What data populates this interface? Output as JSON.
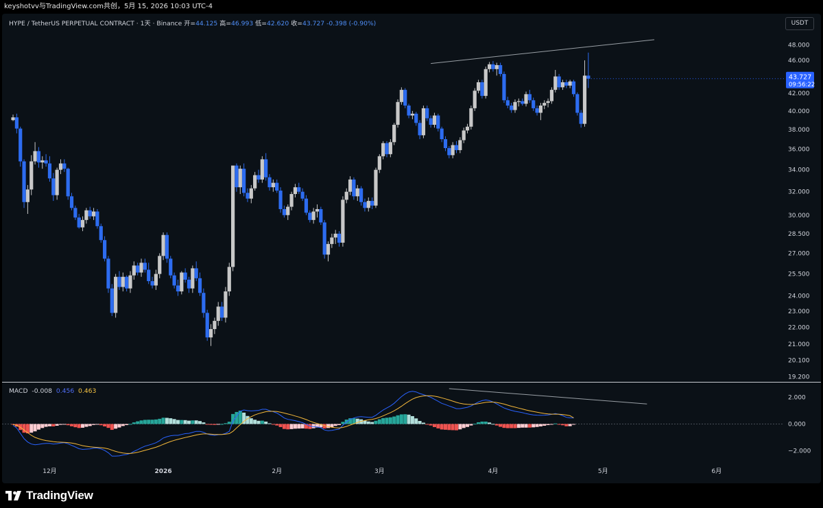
{
  "header": {
    "watermark": "keyshotvv与TradingView.com共创，5月 15, 2026 10:03 UTC-4"
  },
  "symbol": {
    "name": "HYPE / TetherUS PERPETUAL CONTRACT · 1天 · Binance",
    "open_label": "开=",
    "open": "44.125",
    "high_label": "高=",
    "high": "46.993",
    "low_label": "低=",
    "low": "42.620",
    "close_label": "收=",
    "close": "43.727",
    "change": "-0.398 (-0.90%)"
  },
  "currency": "USDT",
  "price_tag": {
    "price": "43.727",
    "countdown": "09:56:22"
  },
  "macd_legend": {
    "label": "MACD",
    "hist": "-0.008",
    "macd": "0.456",
    "signal": "0.463"
  },
  "footer": {
    "brand": "TradingView"
  },
  "colors": {
    "up": "#c8c8c8",
    "down": "#2d6cf0",
    "hist_pos": "#26a69a",
    "hist_pos_light": "#b2dfdb",
    "hist_neg": "#ef5350",
    "hist_neg_light": "#ffcdd2",
    "macd_line": "#2962ff",
    "signal_line": "#f6b93b",
    "background": "#0b1117"
  },
  "chart_data": [
    {
      "type": "candlestick",
      "yscale": "log",
      "ylim": [
        19.0,
        50.0
      ],
      "y_ticks": [
        "48.000",
        "46.000",
        "42.000",
        "40.000",
        "38.000",
        "36.000",
        "34.000",
        "32.000",
        "30.000",
        "28.500",
        "27.000",
        "25.500",
        "24.000",
        "23.000",
        "22.000",
        "21.000",
        "20.100",
        "19.200"
      ],
      "x_ticks": [
        "12月",
        "2026",
        "2月",
        "3月",
        "4月",
        "5月",
        "6月"
      ],
      "x_range": [
        "2025-11-18",
        "2026-06-16"
      ],
      "last_price": 43.727,
      "trendline": {
        "from": {
          "date": "2026-03-15",
          "price": 45.6
        },
        "to": {
          "date": "2026-05-15",
          "price": 48.7
        }
      },
      "candles": [
        [
          39.0,
          39.6,
          38.9,
          39.3
        ],
        [
          39.3,
          39.7,
          37.6,
          38.1
        ],
        [
          38.1,
          38.3,
          34.3,
          34.8
        ],
        [
          34.8,
          35.0,
          30.6,
          31.1
        ],
        [
          31.1,
          32.6,
          30.1,
          32.2
        ],
        [
          32.2,
          35.4,
          31.7,
          34.8
        ],
        [
          34.8,
          36.7,
          34.5,
          35.8
        ],
        [
          35.8,
          36.2,
          34.2,
          34.7
        ],
        [
          34.7,
          35.3,
          34.1,
          34.9
        ],
        [
          34.9,
          35.5,
          34.3,
          34.6
        ],
        [
          34.6,
          35.3,
          32.9,
          33.2
        ],
        [
          33.2,
          33.7,
          31.2,
          31.7
        ],
        [
          31.7,
          34.2,
          31.3,
          34.0
        ],
        [
          34.0,
          35.0,
          33.6,
          34.6
        ],
        [
          34.6,
          35.0,
          33.8,
          34.1
        ],
        [
          34.1,
          34.2,
          31.3,
          31.6
        ],
        [
          31.6,
          31.9,
          30.4,
          30.6
        ],
        [
          30.6,
          30.8,
          29.6,
          29.8
        ],
        [
          29.8,
          30.1,
          28.9,
          29.0
        ],
        [
          29.0,
          29.9,
          28.7,
          29.6
        ],
        [
          29.6,
          30.6,
          29.3,
          30.4
        ],
        [
          30.4,
          30.7,
          29.7,
          29.9
        ],
        [
          29.9,
          30.6,
          29.6,
          30.3
        ],
        [
          30.3,
          30.5,
          28.9,
          29.1
        ],
        [
          29.1,
          29.3,
          27.8,
          28.0
        ],
        [
          28.0,
          28.3,
          26.4,
          26.6
        ],
        [
          26.6,
          26.8,
          24.2,
          24.5
        ],
        [
          24.5,
          24.8,
          22.7,
          22.9
        ],
        [
          22.9,
          25.5,
          22.6,
          25.3
        ],
        [
          25.3,
          25.7,
          24.4,
          24.6
        ],
        [
          24.6,
          25.6,
          24.3,
          25.3
        ],
        [
          25.3,
          25.4,
          24.3,
          24.5
        ],
        [
          24.5,
          25.7,
          24.2,
          25.4
        ],
        [
          25.4,
          26.4,
          25.1,
          26.1
        ],
        [
          26.1,
          26.3,
          25.4,
          25.6
        ],
        [
          25.6,
          26.6,
          25.3,
          26.3
        ],
        [
          26.3,
          26.6,
          25.6,
          25.8
        ],
        [
          25.8,
          26.3,
          24.8,
          25.0
        ],
        [
          25.0,
          25.3,
          24.5,
          24.7
        ],
        [
          24.7,
          25.8,
          24.4,
          25.5
        ],
        [
          25.5,
          27.0,
          25.2,
          26.8
        ],
        [
          26.8,
          28.6,
          26.5,
          28.4
        ],
        [
          28.4,
          28.6,
          26.3,
          26.6
        ],
        [
          26.6,
          26.8,
          25.2,
          25.4
        ],
        [
          25.4,
          25.6,
          24.5,
          24.7
        ],
        [
          24.7,
          25.1,
          24.0,
          24.3
        ],
        [
          24.3,
          25.7,
          24.1,
          25.6
        ],
        [
          25.6,
          25.9,
          24.9,
          25.1
        ],
        [
          25.1,
          25.3,
          24.2,
          24.5
        ],
        [
          24.5,
          26.1,
          24.2,
          25.9
        ],
        [
          25.9,
          26.4,
          25.0,
          25.2
        ],
        [
          25.2,
          25.6,
          24.0,
          24.2
        ],
        [
          24.2,
          24.5,
          22.6,
          22.9
        ],
        [
          22.9,
          23.1,
          21.2,
          21.4
        ],
        [
          21.4,
          22.2,
          20.9,
          21.9
        ],
        [
          21.9,
          22.6,
          21.6,
          22.4
        ],
        [
          22.4,
          23.6,
          22.1,
          23.3
        ],
        [
          23.3,
          23.6,
          22.4,
          22.6
        ],
        [
          22.6,
          24.6,
          22.3,
          24.3
        ],
        [
          24.3,
          26.3,
          24.0,
          26.0
        ],
        [
          26.0,
          34.0,
          25.7,
          34.4
        ],
        [
          34.4,
          34.6,
          32.0,
          32.4
        ],
        [
          32.4,
          34.4,
          31.8,
          34.1
        ],
        [
          34.1,
          34.6,
          31.6,
          31.9
        ],
        [
          31.9,
          32.3,
          31.1,
          31.4
        ],
        [
          31.4,
          32.6,
          31.0,
          32.3
        ],
        [
          32.3,
          33.8,
          32.1,
          33.5
        ],
        [
          33.5,
          34.0,
          32.8,
          33.1
        ],
        [
          33.1,
          35.3,
          32.8,
          35.0
        ],
        [
          35.0,
          35.6,
          33.0,
          33.3
        ],
        [
          33.3,
          33.6,
          32.1,
          32.4
        ],
        [
          32.4,
          33.1,
          32.0,
          32.8
        ],
        [
          32.8,
          33.1,
          31.9,
          32.1
        ],
        [
          32.1,
          32.4,
          30.2,
          30.5
        ],
        [
          30.5,
          30.8,
          29.8,
          30.0
        ],
        [
          30.0,
          30.9,
          29.6,
          30.7
        ],
        [
          30.7,
          32.0,
          30.4,
          31.8
        ],
        [
          31.8,
          32.7,
          31.5,
          32.4
        ],
        [
          32.4,
          32.8,
          31.8,
          32.0
        ],
        [
          32.0,
          32.3,
          31.2,
          31.4
        ],
        [
          31.4,
          31.7,
          30.0,
          30.2
        ],
        [
          30.2,
          30.4,
          29.4,
          29.6
        ],
        [
          29.6,
          30.6,
          29.3,
          30.3
        ],
        [
          30.3,
          30.9,
          29.8,
          30.5
        ],
        [
          30.5,
          30.7,
          29.2,
          29.4
        ],
        [
          29.4,
          29.6,
          26.6,
          26.9
        ],
        [
          26.9,
          27.9,
          26.4,
          27.7
        ],
        [
          27.7,
          28.5,
          27.4,
          28.2
        ],
        [
          28.2,
          28.8,
          27.7,
          28.5
        ],
        [
          28.5,
          28.7,
          27.5,
          27.8
        ],
        [
          27.8,
          31.6,
          27.5,
          31.3
        ],
        [
          31.3,
          32.3,
          31.0,
          32.0
        ],
        [
          32.0,
          33.4,
          31.7,
          33.1
        ],
        [
          33.1,
          33.3,
          31.3,
          31.6
        ],
        [
          31.6,
          32.6,
          31.2,
          32.3
        ],
        [
          32.3,
          32.5,
          30.8,
          31.1
        ],
        [
          31.1,
          31.4,
          30.3,
          30.6
        ],
        [
          30.6,
          31.5,
          30.3,
          31.2
        ],
        [
          31.2,
          31.5,
          30.5,
          30.8
        ],
        [
          30.8,
          34.2,
          30.6,
          34.0
        ],
        [
          34.0,
          35.5,
          33.7,
          35.3
        ],
        [
          35.3,
          36.8,
          35.0,
          36.6
        ],
        [
          36.6,
          36.8,
          35.2,
          35.5
        ],
        [
          35.5,
          37.0,
          35.2,
          36.7
        ],
        [
          36.7,
          38.7,
          36.4,
          38.5
        ],
        [
          38.5,
          41.3,
          38.2,
          41.0
        ],
        [
          41.0,
          42.7,
          40.7,
          42.4
        ],
        [
          42.4,
          42.6,
          40.3,
          40.6
        ],
        [
          40.6,
          40.8,
          39.2,
          39.5
        ],
        [
          39.5,
          40.0,
          39.1,
          39.7
        ],
        [
          39.7,
          39.9,
          38.4,
          38.7
        ],
        [
          38.7,
          39.0,
          37.0,
          37.4
        ],
        [
          37.4,
          40.6,
          37.1,
          40.3
        ],
        [
          40.3,
          40.6,
          38.9,
          39.2
        ],
        [
          39.2,
          39.5,
          38.2,
          38.5
        ],
        [
          38.5,
          39.8,
          38.2,
          39.5
        ],
        [
          39.5,
          39.7,
          37.8,
          38.1
        ],
        [
          38.1,
          38.3,
          36.7,
          37.0
        ],
        [
          37.0,
          37.3,
          35.8,
          36.1
        ],
        [
          36.1,
          36.3,
          35.1,
          35.4
        ],
        [
          35.4,
          36.7,
          35.1,
          36.4
        ],
        [
          36.4,
          36.8,
          35.6,
          35.9
        ],
        [
          35.9,
          37.2,
          35.6,
          36.9
        ],
        [
          36.9,
          38.2,
          36.6,
          37.9
        ],
        [
          37.9,
          38.6,
          37.6,
          38.3
        ],
        [
          38.3,
          40.6,
          38.0,
          40.3
        ],
        [
          40.3,
          42.6,
          40.0,
          42.3
        ],
        [
          42.3,
          43.6,
          42.0,
          43.3
        ],
        [
          43.3,
          43.6,
          41.4,
          41.7
        ],
        [
          41.7,
          45.2,
          41.4,
          44.9
        ],
        [
          44.9,
          45.8,
          44.5,
          45.5
        ],
        [
          45.5,
          45.9,
          44.6,
          44.9
        ],
        [
          44.9,
          45.7,
          44.1,
          45.4
        ],
        [
          45.4,
          45.7,
          44.0,
          44.3
        ],
        [
          44.3,
          44.6,
          40.9,
          41.2
        ],
        [
          41.2,
          41.6,
          40.3,
          40.6
        ],
        [
          40.6,
          40.9,
          39.8,
          40.1
        ],
        [
          40.1,
          41.3,
          39.8,
          41.0
        ],
        [
          41.0,
          41.4,
          40.5,
          41.1
        ],
        [
          41.1,
          41.4,
          40.6,
          40.8
        ],
        [
          40.8,
          42.2,
          40.5,
          41.9
        ],
        [
          41.9,
          42.4,
          40.9,
          41.2
        ],
        [
          41.2,
          41.5,
          40.0,
          40.3
        ],
        [
          40.3,
          40.6,
          39.5,
          39.8
        ],
        [
          39.8,
          40.9,
          39.0,
          40.6
        ],
        [
          40.6,
          41.2,
          40.2,
          40.9
        ],
        [
          40.9,
          41.4,
          40.4,
          41.1
        ],
        [
          41.1,
          42.7,
          40.8,
          42.4
        ],
        [
          42.4,
          44.8,
          42.1,
          44.0
        ],
        [
          44.0,
          44.3,
          42.4,
          42.7
        ],
        [
          42.7,
          43.6,
          42.4,
          43.3
        ],
        [
          43.3,
          43.6,
          42.6,
          42.9
        ],
        [
          42.9,
          43.6,
          42.6,
          43.4
        ],
        [
          43.4,
          43.6,
          41.6,
          41.9
        ],
        [
          41.9,
          42.1,
          39.5,
          39.8
        ],
        [
          39.8,
          40.1,
          38.2,
          38.6
        ],
        [
          38.6,
          46.0,
          38.3,
          44.1
        ],
        [
          44.1,
          46.993,
          42.62,
          43.727
        ]
      ]
    },
    {
      "type": "macd",
      "ylim": [
        -2.9,
        3.0
      ],
      "y_ticks": [
        "2.000",
        "0.000",
        "−2.000"
      ],
      "annotation_line": {
        "from": {
          "date": "2026-03-20",
          "value": 2.65
        },
        "to": {
          "date": "2026-05-13",
          "value": 1.5
        }
      },
      "macd": [
        -0.1,
        -0.3,
        -0.7,
        -1.1,
        -1.35,
        -1.5,
        -1.55,
        -1.52,
        -1.48,
        -1.45,
        -1.45,
        -1.5,
        -1.48,
        -1.42,
        -1.4,
        -1.48,
        -1.6,
        -1.72,
        -1.85,
        -1.9,
        -1.88,
        -1.86,
        -1.8,
        -1.8,
        -1.86,
        -1.98,
        -2.15,
        -2.4,
        -2.4,
        -2.38,
        -2.32,
        -2.28,
        -2.2,
        -2.05,
        -1.92,
        -1.78,
        -1.66,
        -1.58,
        -1.5,
        -1.4,
        -1.25,
        -1.05,
        -0.95,
        -0.88,
        -0.85,
        -0.85,
        -0.78,
        -0.72,
        -0.7,
        -0.62,
        -0.55,
        -0.55,
        -0.62,
        -0.75,
        -0.82,
        -0.85,
        -0.8,
        -0.78,
        -0.7,
        -0.55,
        0.2,
        0.6,
        0.95,
        1.05,
        1.0,
        0.98,
        1.0,
        1.02,
        1.1,
        1.1,
        1.0,
        0.92,
        0.82,
        0.65,
        0.45,
        0.35,
        0.3,
        0.25,
        0.18,
        0.1,
        -0.02,
        -0.15,
        -0.2,
        -0.22,
        -0.28,
        -0.45,
        -0.5,
        -0.48,
        -0.42,
        -0.38,
        -0.1,
        0.15,
        0.35,
        0.45,
        0.52,
        0.55,
        0.52,
        0.5,
        0.5,
        0.65,
        0.85,
        1.05,
        1.2,
        1.35,
        1.55,
        1.8,
        2.05,
        2.25,
        2.4,
        2.45,
        2.4,
        2.28,
        2.2,
        2.1,
        2.0,
        1.85,
        1.7,
        1.55,
        1.45,
        1.35,
        1.25,
        1.15,
        1.15,
        1.2,
        1.25,
        1.35,
        1.5,
        1.65,
        1.75,
        1.8,
        1.75,
        1.65,
        1.5,
        1.35,
        1.2,
        1.1,
        1.02,
        0.95,
        0.9,
        0.85,
        0.78,
        0.72,
        0.68,
        0.66,
        0.65,
        0.66,
        0.68,
        0.72,
        0.78,
        0.72,
        0.62,
        0.5,
        0.46,
        0.456
      ],
      "signal": [
        -0.05,
        -0.1,
        -0.25,
        -0.45,
        -0.65,
        -0.85,
        -1.0,
        -1.1,
        -1.18,
        -1.24,
        -1.28,
        -1.32,
        -1.35,
        -1.36,
        -1.37,
        -1.39,
        -1.43,
        -1.48,
        -1.55,
        -1.62,
        -1.67,
        -1.71,
        -1.73,
        -1.75,
        -1.77,
        -1.8,
        -1.86,
        -1.96,
        -2.05,
        -2.12,
        -2.17,
        -2.2,
        -2.2,
        -2.17,
        -2.12,
        -2.05,
        -1.97,
        -1.9,
        -1.82,
        -1.74,
        -1.64,
        -1.52,
        -1.41,
        -1.31,
        -1.22,
        -1.15,
        -1.08,
        -1.01,
        -0.95,
        -0.89,
        -0.82,
        -0.77,
        -0.74,
        -0.74,
        -0.76,
        -0.78,
        -0.78,
        -0.78,
        -0.76,
        -0.72,
        -0.55,
        -0.3,
        -0.05,
        0.2,
        0.4,
        0.55,
        0.68,
        0.78,
        0.85,
        0.92,
        0.95,
        0.95,
        0.93,
        0.88,
        0.82,
        0.75,
        0.68,
        0.6,
        0.52,
        0.43,
        0.33,
        0.22,
        0.12,
        0.04,
        -0.03,
        -0.12,
        -0.2,
        -0.25,
        -0.28,
        -0.3,
        -0.26,
        -0.18,
        -0.08,
        0.02,
        0.12,
        0.2,
        0.26,
        0.31,
        0.35,
        0.41,
        0.5,
        0.61,
        0.73,
        0.85,
        0.99,
        1.15,
        1.33,
        1.52,
        1.7,
        1.86,
        1.98,
        2.05,
        2.1,
        2.12,
        2.11,
        2.08,
        2.03,
        1.96,
        1.88,
        1.8,
        1.71,
        1.62,
        1.55,
        1.5,
        1.47,
        1.46,
        1.48,
        1.52,
        1.57,
        1.62,
        1.64,
        1.64,
        1.61,
        1.56,
        1.49,
        1.41,
        1.33,
        1.26,
        1.19,
        1.12,
        1.05,
        0.99,
        0.93,
        0.88,
        0.83,
        0.79,
        0.76,
        0.74,
        0.74,
        0.73,
        0.71,
        0.67,
        0.62,
        0.463
      ]
    }
  ]
}
